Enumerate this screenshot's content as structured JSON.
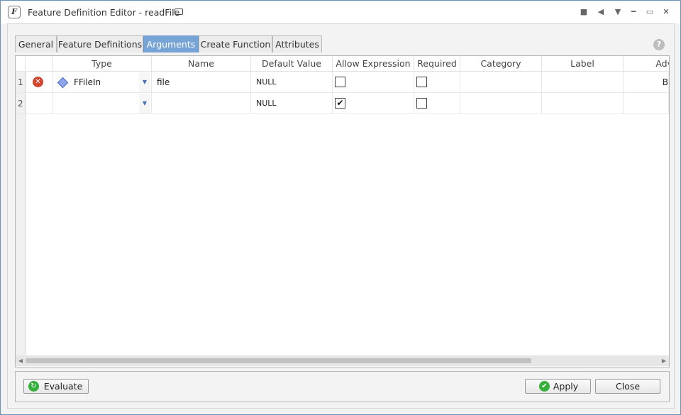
{
  "window": {
    "title": "Feature Definition Editor - readFile",
    "app_icon_letter": "F"
  },
  "tabs": [
    {
      "label": "General",
      "active": false
    },
    {
      "label": "Feature Definitions",
      "active": false
    },
    {
      "label": "Arguments",
      "active": true
    },
    {
      "label": "Create Function",
      "active": false
    },
    {
      "label": "Attributes",
      "active": false
    }
  ],
  "grid": {
    "columns": [
      "Type",
      "Name",
      "Default Value",
      "Allow Expression",
      "Required",
      "Category",
      "Label",
      "Adv"
    ],
    "rows": [
      {
        "num": "1",
        "has_error": true,
        "type_icon": "diamond-icon",
        "type": "FFileIn",
        "name": "file",
        "default": "NULL",
        "allow_expression": false,
        "required": false,
        "category": "",
        "label": "",
        "adv": "B"
      },
      {
        "num": "2",
        "has_error": false,
        "type_icon": "",
        "type": "",
        "name": "",
        "default": "NULL",
        "allow_expression": true,
        "required": false,
        "category": "",
        "label": "",
        "adv": ""
      }
    ]
  },
  "buttons": {
    "evaluate": "Evaluate",
    "apply": "Apply",
    "close": "Close"
  },
  "colors": {
    "active_tab": "#77a4d6",
    "error": "#d2452e",
    "success": "#35b03b"
  }
}
